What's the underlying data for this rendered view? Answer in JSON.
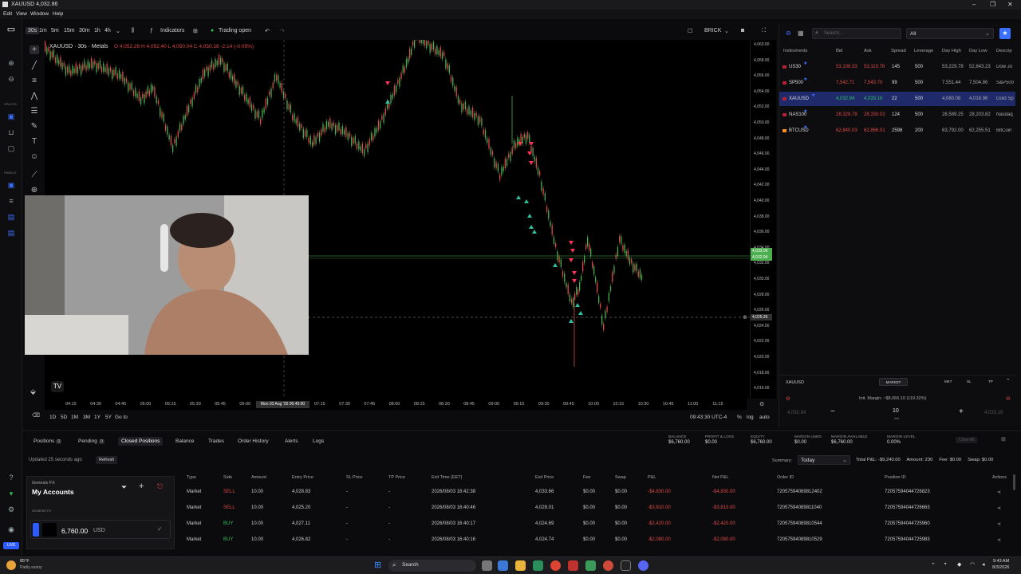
{
  "window": {
    "title": "XAUUSD 4,032.86"
  },
  "menu": [
    "Edit",
    "View",
    "Window",
    "Help"
  ],
  "leftbar": {
    "spaces_label": "SPACES",
    "panels_label": "PANELS",
    "live_label": "LIVE"
  },
  "toolbar": {
    "intervals": [
      "30s",
      "1m",
      "5m",
      "15m",
      "30m",
      "1h",
      "4h"
    ],
    "active_interval": "30s",
    "indicators": "Indicators",
    "trading_open": "Trading open",
    "account": "BRICK"
  },
  "chart": {
    "title": "XAUUSD · 30s · Metals",
    "ohlc": "O 4,052.26 H 4,052.40 L 4,050.04 C 4,050.18 -2.14 (-0.05%)",
    "y_labels": [
      "4,060.00",
      "4,058.00",
      "4,056.00",
      "4,054.00",
      "4,052.00",
      "4,050.00",
      "4,048.00",
      "4,046.00",
      "4,044.00",
      "4,042.00",
      "4,040.00",
      "4,038.00",
      "4,036.00",
      "4,034.00",
      "4,032.00",
      "4,030.00",
      "4,028.00",
      "4,026.00",
      "4,024.00",
      "4,022.00",
      "4,020.00",
      "4,018.00",
      "4,016.00"
    ],
    "price_tag_ask": "4,033.06",
    "price_tag_bid": "4,032.94",
    "crosshair_price": "4,025.26",
    "x_labels": [
      "04:15",
      "04:30",
      "04:45",
      "05:00",
      "05:15",
      "05:30",
      "05:45",
      "06:00",
      "06:15",
      "07:00",
      "07:15",
      "07:30",
      "07:45",
      "08:00",
      "08:15",
      "08:30",
      "08:45",
      "09:00",
      "09:15",
      "09:30",
      "09:45",
      "10:00",
      "10:15",
      "10:30",
      "10:45",
      "11:00",
      "11:15"
    ],
    "crosshair_date": "Mon 03 Aug '26 06:40:00",
    "timeframes": [
      "1D",
      "5D",
      "1M",
      "3M",
      "1Y",
      "5Y"
    ],
    "goto": "Go to",
    "clock": "09:43:30 UTC-4",
    "axis_opts": [
      "%",
      "log",
      "auto"
    ]
  },
  "instruments": {
    "search_placeholder": "Search...",
    "filter": "All",
    "headers": [
      "Instruments",
      "Bid",
      "Ask",
      "Spread",
      "Leverage",
      "Day High",
      "Day Low",
      "Descrip"
    ],
    "rows": [
      {
        "name": "US30",
        "bid": "53,108.33",
        "ask": "53,110.78",
        "spread": "145",
        "lev": "500",
        "high": "53,229.78",
        "low": "52,843.23",
        "desc": "Dow Jo"
      },
      {
        "name": "SP500",
        "bid": "7,542.71",
        "ask": "7,543.70",
        "spread": "99",
        "lev": "500",
        "high": "7,551.44",
        "low": "7,504.86",
        "desc": "S&P500"
      },
      {
        "name": "XAUUSD",
        "bid": "4,032.94",
        "ask": "4,033.16",
        "spread": "22",
        "lev": "500",
        "high": "4,080.08",
        "low": "4,018.96",
        "desc": "Gold Sp"
      },
      {
        "name": "NAS100",
        "bid": "28,328.78",
        "ask": "28,330.02",
        "spread": "124",
        "lev": "500",
        "high": "28,589.25",
        "low": "28,203.82",
        "desc": "Nasdaq"
      },
      {
        "name": "BTCUSD",
        "bid": "62,840.03",
        "ask": "62,866.01",
        "spread": "2598",
        "lev": "200",
        "high": "63,792.00",
        "low": "62,255.51",
        "desc": "BitCoin"
      }
    ]
  },
  "order": {
    "symbol": "XAUUSD",
    "type": "MARKET",
    "buttons": [
      "MKT",
      "SL",
      "TP"
    ],
    "margin": "Init. Margin: ~$8,066.10 (119.32%)",
    "sell_price": "4,032.94",
    "buy_price": "4,033.16",
    "lots": "10",
    "lots_label": "lots"
  },
  "bottom": {
    "tabs": [
      {
        "label": "Positions",
        "count": "0"
      },
      {
        "label": "Pending",
        "count": "0"
      },
      {
        "label": "Closed Positions"
      },
      {
        "label": "Balance"
      },
      {
        "label": "Trades"
      },
      {
        "label": "Order History"
      },
      {
        "label": "Alerts"
      },
      {
        "label": "Logs"
      }
    ],
    "stats": [
      {
        "k": "BALANCE",
        "v": "$6,760.00"
      },
      {
        "k": "PROFIT & LOSS",
        "v": "$0.00"
      },
      {
        "k": "EQUITY",
        "v": "$6,760.00"
      },
      {
        "k": "MARGIN USED",
        "v": "$0.00"
      },
      {
        "k": "MARGIN AVAILABLE",
        "v": "$6,760.00"
      },
      {
        "k": "MARGIN LEVEL",
        "v": "0.00%"
      }
    ],
    "close_all": "Close All",
    "updated": "Updated 25 seconds ago",
    "refresh": "Refresh",
    "summary_label": "Summary:",
    "summary_value": "Today",
    "totals": "Total P&L: -$9,240.00     Amount: 230     Fee: $0.00     Swap: $0.00",
    "headers": [
      "Type",
      "Side",
      "Amount",
      "Entry Price",
      "SL Price",
      "TP Price",
      "Exit Time (EET)",
      "Exit Price",
      "Fee",
      "Swap",
      "P&L",
      "Net P&L",
      "Order ID",
      "Position ID",
      "Actions"
    ],
    "rows": [
      {
        "type": "Market",
        "side": "SELL",
        "amount": "10.00",
        "entry": "4,028.83",
        "sl": "-",
        "tp": "-",
        "exit_time": "2026/08/03 16:42:38",
        "exit": "4,033.66",
        "fee": "$0.00",
        "swap": "$0.00",
        "pnl": "-$4,830.00",
        "net": "-$4,830.00",
        "order": "72057594089812402",
        "pos": "72057594044726823"
      },
      {
        "type": "Market",
        "side": "SELL",
        "amount": "10.00",
        "entry": "4,025.20",
        "sl": "-",
        "tp": "-",
        "exit_time": "2026/08/03 16:40:46",
        "exit": "4,029.01",
        "fee": "$0.00",
        "swap": "$0.00",
        "pnl": "-$3,810.00",
        "net": "-$3,810.00",
        "order": "72057594089811040",
        "pos": "72057594044726663"
      },
      {
        "type": "Market",
        "side": "BUY",
        "amount": "10.00",
        "entry": "4,027.11",
        "sl": "-",
        "tp": "-",
        "exit_time": "2026/08/03 16:40:17",
        "exit": "4,024.69",
        "fee": "$0.00",
        "swap": "$0.00",
        "pnl": "-$2,420.00",
        "net": "-$2,420.00",
        "order": "72057594089810544",
        "pos": "72057594044725960"
      },
      {
        "type": "Market",
        "side": "BUY",
        "amount": "10.00",
        "entry": "4,026.82",
        "sl": "-",
        "tp": "-",
        "exit_time": "2026/08/03 16:40:16",
        "exit": "4,024.74",
        "fee": "$0.00",
        "swap": "$0.00",
        "pnl": "-$2,080.00",
        "net": "-$2,080.00",
        "order": "72057594089810529",
        "pos": "72057594044725983"
      }
    ]
  },
  "account": {
    "broker": "Genesis FX",
    "title": "My Accounts",
    "sub": "GENESIS FX",
    "balance": "6,760.00",
    "currency": "USD"
  },
  "taskbar": {
    "temp": "85°F",
    "weather": "Partly sunny",
    "search": "Search",
    "time": "9:43 AM",
    "date": "8/3/2026"
  }
}
